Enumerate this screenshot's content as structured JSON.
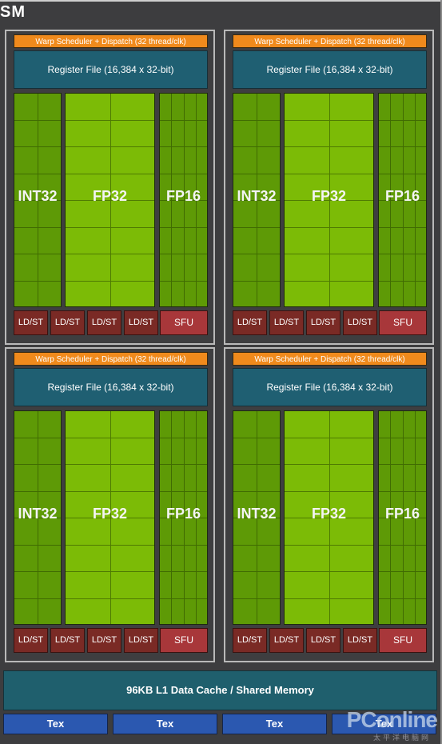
{
  "title": "SM",
  "quadrants": [
    {
      "warp": "Warp Scheduler + Dispatch (32 thread/clk)",
      "register_file": "Register File (16,384 x 32-bit)",
      "int_label": "INT32",
      "fp32_label": "FP32",
      "fp16_label": "FP16",
      "ldst": [
        "LD/ST",
        "LD/ST",
        "LD/ST",
        "LD/ST"
      ],
      "sfu": "SFU"
    },
    {
      "warp": "Warp Scheduler + Dispatch (32 thread/clk)",
      "register_file": "Register File (16,384 x 32-bit)",
      "int_label": "INT32",
      "fp32_label": "FP32",
      "fp16_label": "FP16",
      "ldst": [
        "LD/ST",
        "LD/ST",
        "LD/ST",
        "LD/ST"
      ],
      "sfu": "SFU"
    },
    {
      "warp": "Warp Scheduler + Dispatch (32 thread/clk)",
      "register_file": "Register File (16,384 x 32-bit)",
      "int_label": "INT32",
      "fp32_label": "FP32",
      "fp16_label": "FP16",
      "ldst": [
        "LD/ST",
        "LD/ST",
        "LD/ST",
        "LD/ST"
      ],
      "sfu": "SFU"
    },
    {
      "warp": "Warp Scheduler + Dispatch (32 thread/clk)",
      "register_file": "Register File (16,384 x 32-bit)",
      "int_label": "INT32",
      "fp32_label": "FP32",
      "fp16_label": "FP16",
      "ldst": [
        "LD/ST",
        "LD/ST",
        "LD/ST",
        "LD/ST"
      ],
      "sfu": "SFU"
    }
  ],
  "cache": "96KB L1 Data Cache / Shared Memory",
  "tex_units": [
    "Tex",
    "Tex",
    "Tex",
    "Tex"
  ],
  "watermark": {
    "brand": "PConline",
    "sub": "太平洋电脑网"
  },
  "colors": {
    "warp": "#f08a1c",
    "register_file": "#1f5f72",
    "int32": "#5e9a06",
    "fp32": "#7cbb06",
    "ldst": "#7a2a25",
    "sfu": "#a8373a",
    "cache": "#1f5f6d",
    "tex": "#2b58b0"
  }
}
